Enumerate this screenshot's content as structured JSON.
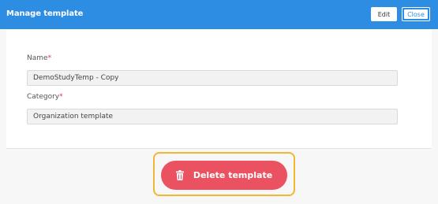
{
  "header": {
    "title": "Manage template",
    "edit_label": "Edit",
    "close_label": "Close"
  },
  "form": {
    "name_label": "Name",
    "name_value": "DemoStudyTemp - Copy",
    "category_label": "Category",
    "category_value": "Organization template",
    "required_marker": "*"
  },
  "footer": {
    "delete_label": "Delete template",
    "delete_icon": "trash-icon"
  },
  "colors": {
    "header_bg": "#2d8de3",
    "delete_bg": "#ea5261",
    "highlight": "#f1b632",
    "required": "#e0334a"
  }
}
